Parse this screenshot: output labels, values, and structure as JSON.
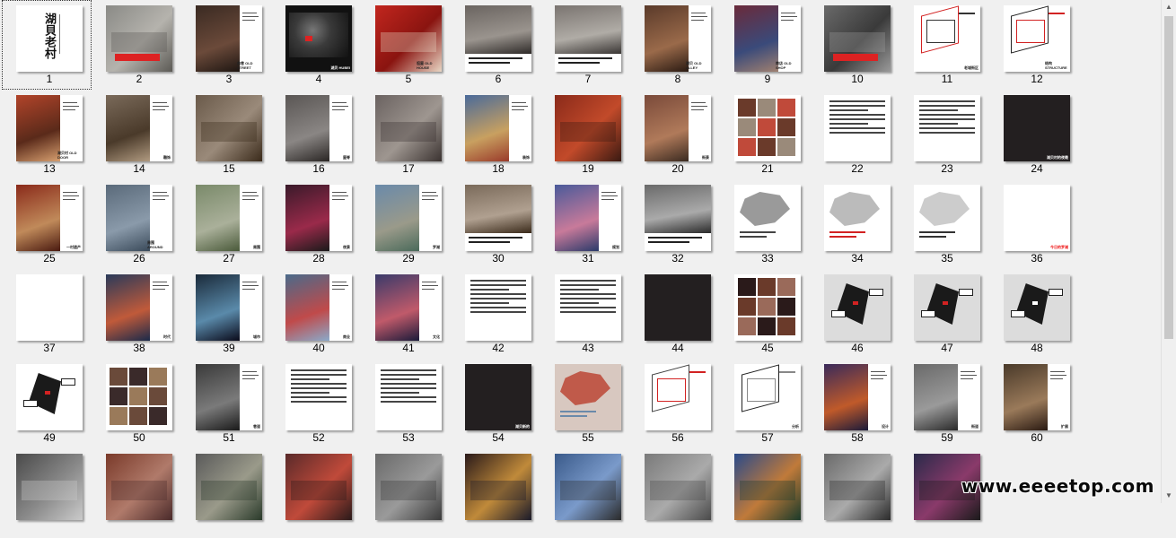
{
  "slides": [
    {
      "num": "1",
      "style": "title",
      "title": "湖貝老村",
      "selected": true
    },
    {
      "num": "2",
      "style": "photo",
      "colors": [
        "#8a8a86",
        "#b5b3ad",
        "#5c5a55"
      ],
      "accent": "#d22"
    },
    {
      "num": "3",
      "style": "photo-split",
      "colors": [
        "#3a2a22",
        "#6b4a3a",
        "#1e1612"
      ],
      "caption": "曲巷 OLD STREET"
    },
    {
      "num": "4",
      "style": "dark",
      "colors": [
        "#111111",
        "#3a3a3a",
        "#777777"
      ],
      "caption": "湖贝 HUBEI"
    },
    {
      "num": "5",
      "style": "photo",
      "colors": [
        "#c2261e",
        "#8a1410",
        "#e8d6c4"
      ],
      "caption": "祖屋 OLD HOUSE"
    },
    {
      "num": "6",
      "style": "photo-top",
      "colors": [
        "#6a6460",
        "#9a948e",
        "#2e2a28"
      ]
    },
    {
      "num": "7",
      "style": "photo-top",
      "colors": [
        "#7a7470",
        "#b0aca6",
        "#3a3634"
      ]
    },
    {
      "num": "8",
      "style": "photo-split",
      "colors": [
        "#5a3a2a",
        "#9a6a4a",
        "#2a1a12"
      ],
      "caption": "湖贝 OLD ALLEY"
    },
    {
      "num": "9",
      "style": "photo-split",
      "colors": [
        "#6a2a3a",
        "#3a4a7a",
        "#a08070"
      ],
      "caption": "商店 OLD SHOP"
    },
    {
      "num": "10",
      "style": "photo",
      "colors": [
        "#6a6a6a",
        "#3a3a3a",
        "#9a9a9a"
      ],
      "accent": "#d22"
    },
    {
      "num": "11",
      "style": "diagram",
      "colors": [
        "#ffffff",
        "#d22222",
        "#333333"
      ],
      "caption": "老城街区"
    },
    {
      "num": "12",
      "style": "diagram",
      "colors": [
        "#ffffff",
        "#222222",
        "#d22222"
      ],
      "caption": "结构 STRUCTURE"
    },
    {
      "num": "13",
      "style": "photo-split",
      "colors": [
        "#b2442a",
        "#5a2a1a",
        "#d8a070"
      ],
      "caption": "湖贝村 OLD DOOR"
    },
    {
      "num": "14",
      "style": "photo-split",
      "colors": [
        "#7a6a5a",
        "#4a3a2a",
        "#b09a80"
      ],
      "caption": "雕饰"
    },
    {
      "num": "15",
      "style": "photo",
      "colors": [
        "#6a5a4a",
        "#9a8a7a",
        "#3a2a1a"
      ]
    },
    {
      "num": "16",
      "style": "photo-split",
      "colors": [
        "#5a5654",
        "#8a8684",
        "#2a2624"
      ],
      "caption": "屋脊"
    },
    {
      "num": "17",
      "style": "photo",
      "colors": [
        "#6a6260",
        "#9e9690",
        "#3a3230"
      ]
    },
    {
      "num": "18",
      "style": "photo-split",
      "colors": [
        "#4a6a9a",
        "#c8a060",
        "#9a3a2a"
      ],
      "caption": "装饰"
    },
    {
      "num": "19",
      "style": "photo",
      "colors": [
        "#8a2a1a",
        "#c24a2a",
        "#3a1a12"
      ]
    },
    {
      "num": "20",
      "style": "photo-split",
      "colors": [
        "#7a4a3a",
        "#b07a5a",
        "#3a2a20"
      ],
      "caption": "街景"
    },
    {
      "num": "21",
      "style": "collage",
      "colors": [
        "#6a3a2a",
        "#9a8a7a",
        "#c04a3a"
      ]
    },
    {
      "num": "22",
      "style": "text",
      "colors": [
        "#ffffff"
      ]
    },
    {
      "num": "23",
      "style": "text",
      "colors": [
        "#ffffff"
      ]
    },
    {
      "num": "24",
      "style": "black",
      "colors": [
        "#231f20"
      ],
      "caption": "湖贝村的夜晚"
    },
    {
      "num": "25",
      "style": "photo-split",
      "colors": [
        "#8a2a1a",
        "#c08a5a",
        "#4a1a10"
      ],
      "caption": "一村遗产"
    },
    {
      "num": "26",
      "style": "photo-split",
      "colors": [
        "#5a6a7a",
        "#8a9aaa",
        "#3a4a5a"
      ],
      "caption": "周围 AROUND"
    },
    {
      "num": "27",
      "style": "photo-split",
      "colors": [
        "#7a8a6a",
        "#aab09a",
        "#4a5a3a"
      ],
      "caption": "周围"
    },
    {
      "num": "28",
      "style": "photo-split",
      "colors": [
        "#3a1a2a",
        "#9a2a4a",
        "#1a1a1a"
      ],
      "caption": "夜景"
    },
    {
      "num": "29",
      "style": "photo-split",
      "colors": [
        "#6a8aaa",
        "#9a9a8a",
        "#4a6a5a"
      ],
      "caption": "罗湖"
    },
    {
      "num": "30",
      "style": "photo-top",
      "colors": [
        "#7a6a5a",
        "#b0a090",
        "#3a2a1a"
      ]
    },
    {
      "num": "31",
      "style": "photo-split",
      "colors": [
        "#4a5a9a",
        "#c87a9a",
        "#2a3a6a"
      ],
      "caption": "规划"
    },
    {
      "num": "32",
      "style": "photo-top",
      "colors": [
        "#6a6a6a",
        "#aaaaaa",
        "#2a2a2a"
      ]
    },
    {
      "num": "33",
      "style": "map",
      "colors": [
        "#ffffff",
        "#9a9a9a",
        "#444444"
      ]
    },
    {
      "num": "34",
      "style": "map",
      "colors": [
        "#ffffff",
        "#bbbbbb",
        "#d22222"
      ]
    },
    {
      "num": "35",
      "style": "map",
      "colors": [
        "#ffffff",
        "#cccccc",
        "#333333"
      ]
    },
    {
      "num": "36",
      "style": "blank-cap",
      "colors": [
        "#ffffff"
      ],
      "caption": "今日的罗湖"
    },
    {
      "num": "37",
      "style": "blank",
      "colors": [
        "#ffffff"
      ]
    },
    {
      "num": "38",
      "style": "photo-split",
      "colors": [
        "#2a3a5a",
        "#c05a3a",
        "#1a2a4a"
      ],
      "caption": "时代"
    },
    {
      "num": "39",
      "style": "photo-split",
      "colors": [
        "#1a2a3a",
        "#5a8aaa",
        "#0a0a1a"
      ],
      "caption": "城市"
    },
    {
      "num": "40",
      "style": "photo-split",
      "colors": [
        "#4a6a8a",
        "#c04a4a",
        "#8aaaca"
      ],
      "caption": "商业"
    },
    {
      "num": "41",
      "style": "photo-split",
      "colors": [
        "#3a3a6a",
        "#c05a6a",
        "#1a1a3a"
      ],
      "caption": "文化"
    },
    {
      "num": "42",
      "style": "text",
      "colors": [
        "#ffffff"
      ]
    },
    {
      "num": "43",
      "style": "text",
      "colors": [
        "#ffffff"
      ]
    },
    {
      "num": "44",
      "style": "black",
      "colors": [
        "#231f20"
      ]
    },
    {
      "num": "45",
      "style": "collage",
      "colors": [
        "#2a1a1a",
        "#6a3a2a",
        "#9a6a5a"
      ]
    },
    {
      "num": "46",
      "style": "diagram-dark",
      "colors": [
        "#dcdcdc",
        "#1a1a1a",
        "#d22222"
      ]
    },
    {
      "num": "47",
      "style": "diagram-dark",
      "colors": [
        "#dcdcdc",
        "#1a1a1a",
        "#d22222"
      ]
    },
    {
      "num": "48",
      "style": "diagram-dark",
      "colors": [
        "#dcdcdc",
        "#1a1a1a",
        "#ffffff"
      ]
    },
    {
      "num": "49",
      "style": "diagram-dark",
      "colors": [
        "#ffffff",
        "#1a1a1a",
        "#d22222"
      ]
    },
    {
      "num": "50",
      "style": "collage",
      "colors": [
        "#6a4a3a",
        "#3a2a2a",
        "#9a7a5a"
      ]
    },
    {
      "num": "51",
      "style": "photo-split",
      "colors": [
        "#3a3a3a",
        "#7a7a7a",
        "#1a1a1a"
      ],
      "caption": "巷道"
    },
    {
      "num": "52",
      "style": "text",
      "colors": [
        "#ffffff"
      ]
    },
    {
      "num": "53",
      "style": "text",
      "colors": [
        "#ffffff"
      ]
    },
    {
      "num": "54",
      "style": "black",
      "colors": [
        "#231f20"
      ],
      "caption": "湖贝新的"
    },
    {
      "num": "55",
      "style": "map",
      "colors": [
        "#d8c8c0",
        "#c05a4a",
        "#6a8aaa"
      ]
    },
    {
      "num": "56",
      "style": "diagram",
      "colors": [
        "#ffffff",
        "#444444",
        "#d22222"
      ]
    },
    {
      "num": "57",
      "style": "diagram",
      "colors": [
        "#ffffff",
        "#222222",
        "#888888"
      ],
      "caption": "分析"
    },
    {
      "num": "58",
      "style": "photo-split",
      "colors": [
        "#3a2a5a",
        "#c05a2a",
        "#1a1a3a"
      ],
      "caption": "设计"
    },
    {
      "num": "59",
      "style": "photo-split",
      "colors": [
        "#6a6a6a",
        "#9a9a9a",
        "#2a2a2a"
      ],
      "caption": "街道"
    },
    {
      "num": "60",
      "style": "photo-split",
      "colors": [
        "#4a3a2a",
        "#9a7a5a",
        "#2a1a12"
      ],
      "caption": "扩展"
    },
    {
      "num": "",
      "style": "photo",
      "colors": [
        "#4a4a4a",
        "#8a8a8a",
        "#cacaca"
      ]
    },
    {
      "num": "",
      "style": "photo",
      "colors": [
        "#7a3a2a",
        "#b07a6a",
        "#4a2a2a"
      ]
    },
    {
      "num": "",
      "style": "photo",
      "colors": [
        "#5a5a5a",
        "#9a9a8a",
        "#2a3a2a"
      ]
    },
    {
      "num": "",
      "style": "photo",
      "colors": [
        "#5a2a2a",
        "#c04a3a",
        "#2a1a1a"
      ]
    },
    {
      "num": "",
      "style": "photo",
      "colors": [
        "#6a6a6a",
        "#9a9a9a",
        "#3a3a3a"
      ]
    },
    {
      "num": "",
      "style": "photo",
      "colors": [
        "#2a1a1a",
        "#c08a3a",
        "#1a1a2a"
      ]
    },
    {
      "num": "",
      "style": "photo",
      "colors": [
        "#3a5a8a",
        "#7a9aca",
        "#2a2a2a"
      ]
    },
    {
      "num": "",
      "style": "photo",
      "colors": [
        "#7a7a7a",
        "#aaaaaa",
        "#4a4a4a"
      ]
    },
    {
      "num": "",
      "style": "photo",
      "colors": [
        "#2a4a8a",
        "#c07a3a",
        "#1a3a2a"
      ]
    },
    {
      "num": "",
      "style": "photo",
      "colors": [
        "#6a6a6a",
        "#aaaaaa",
        "#2a2a2a"
      ]
    },
    {
      "num": "",
      "style": "photo",
      "colors": [
        "#2a2a4a",
        "#8a3a6a",
        "#1a1a1a"
      ]
    }
  ],
  "watermark": "www.eeeetop.com"
}
